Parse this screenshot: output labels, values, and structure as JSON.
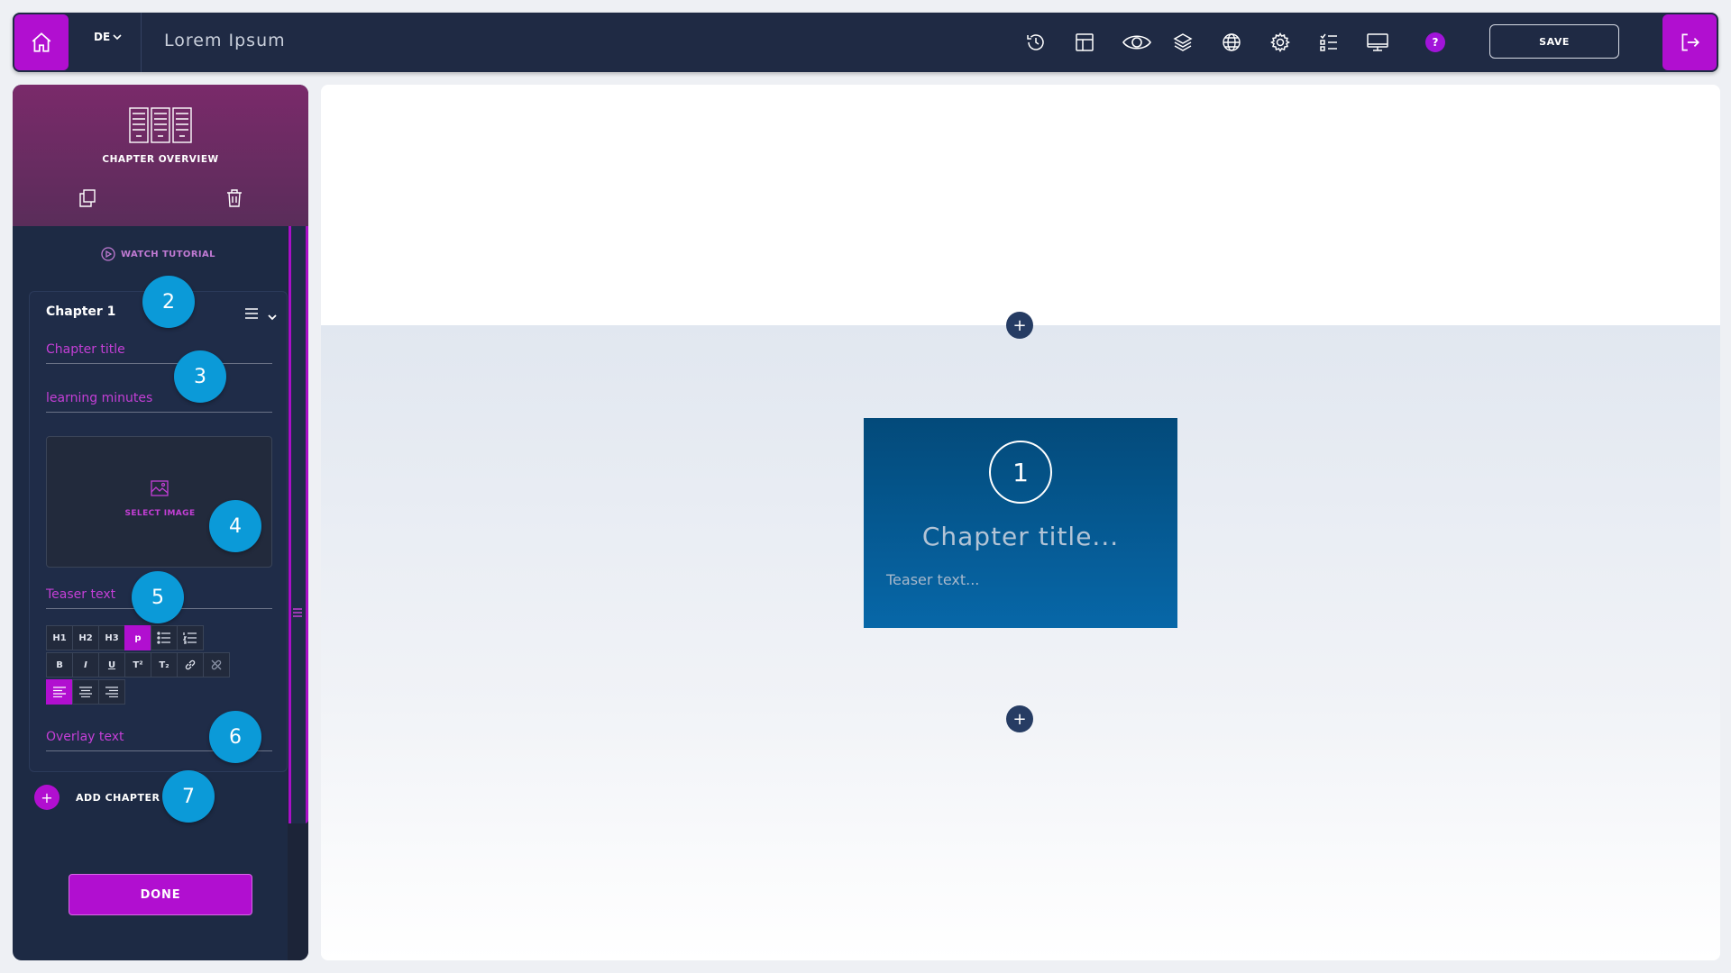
{
  "topbar": {
    "language": "DE",
    "title": "Lorem Ipsum",
    "help_label": "?",
    "save_label": "SAVE",
    "icons": [
      "history-icon",
      "layout-icon",
      "eye-icon",
      "layers-icon",
      "globe-icon",
      "gear-icon",
      "checklist-icon",
      "monitor-icon",
      "help-icon"
    ]
  },
  "sidebar": {
    "header_title": "CHAPTER OVERVIEW",
    "tutorial_label": "WATCH TUTORIAL",
    "chapter": {
      "heading": "Chapter 1",
      "title_placeholder": "Chapter title",
      "minutes_placeholder": "learning minutes",
      "select_image_label": "SELECT IMAGE",
      "teaser_placeholder": "Teaser text",
      "overlay_placeholder": "Overlay text",
      "format_buttons": [
        "H1",
        "H2",
        "H3",
        "p"
      ],
      "style_buttons": [
        "B",
        "I",
        "U",
        "T²",
        "T₂"
      ]
    },
    "add_chapter_label": "ADD CHAPTER",
    "done_label": "DONE"
  },
  "badges": [
    "2",
    "3",
    "4",
    "5",
    "6",
    "7"
  ],
  "canvas": {
    "tile": {
      "number": "1",
      "title": "Chapter title...",
      "teaser": "Teaser text..."
    },
    "add_symbol": "+"
  },
  "colors": {
    "accent": "#b10fd0",
    "topbar": "#1f2a44",
    "badge": "#0b9ad8",
    "tile": "#0767a8"
  }
}
